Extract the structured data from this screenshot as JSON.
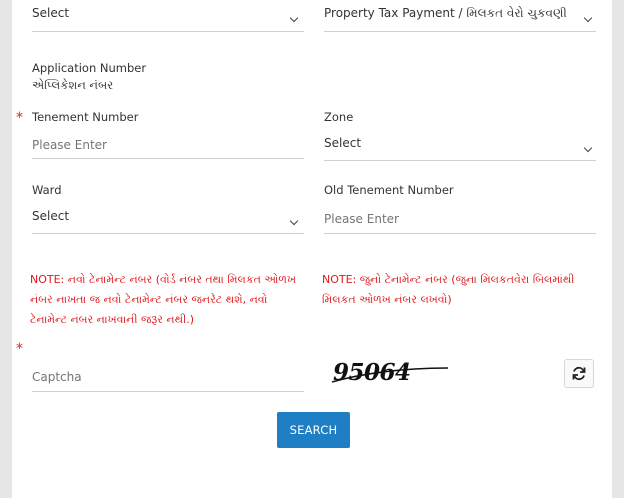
{
  "form": {
    "select_top_left": {
      "value": "Select"
    },
    "service_type": {
      "value": "Property Tax Payment / મિલકત વેરો ચુકવણી"
    },
    "application_number": {
      "label": "Application Number",
      "label_gu": "એપ્લિકેશન નંબર"
    },
    "tenement_number": {
      "label": "Tenement Number",
      "placeholder": "Please Enter",
      "required_mark": "*"
    },
    "zone": {
      "label": "Zone",
      "value": "Select"
    },
    "ward": {
      "label": "Ward",
      "value": "Select"
    },
    "old_tenement_number": {
      "label": "Old Tenement Number",
      "placeholder": "Please Enter"
    },
    "notes": {
      "left_lines": [
        "NOTE: નવો ટેનામેન્ટ નંબર (વોર્ડ નંબર તથા મિલકત ઓળખ",
        "નંબર નાખતા જ નવો ટેનામેન્ટ નંબર જનરેટ થશે, નવો",
        "ટેનામેન્ટ નંબર નાખવાની જરૂર નથી.)"
      ],
      "right_lines": [
        "NOTE: જુનો ટેનામેન્ટ નંબર (જુના મિલકતવેરા બિલમાંથી",
        "મિલકત ઓળખ નંબર લખવો)"
      ]
    },
    "captcha": {
      "placeholder": "Captcha",
      "code": "95064",
      "required_mark": "*"
    },
    "search_button": {
      "label": "SEARCH"
    }
  },
  "colors": {
    "accent": "#1f7fc4",
    "note_red": "#e0191c",
    "required_red": "#e02020"
  },
  "icons": {
    "dropdown": "chevron-down-icon",
    "refresh": "refresh-icon"
  }
}
